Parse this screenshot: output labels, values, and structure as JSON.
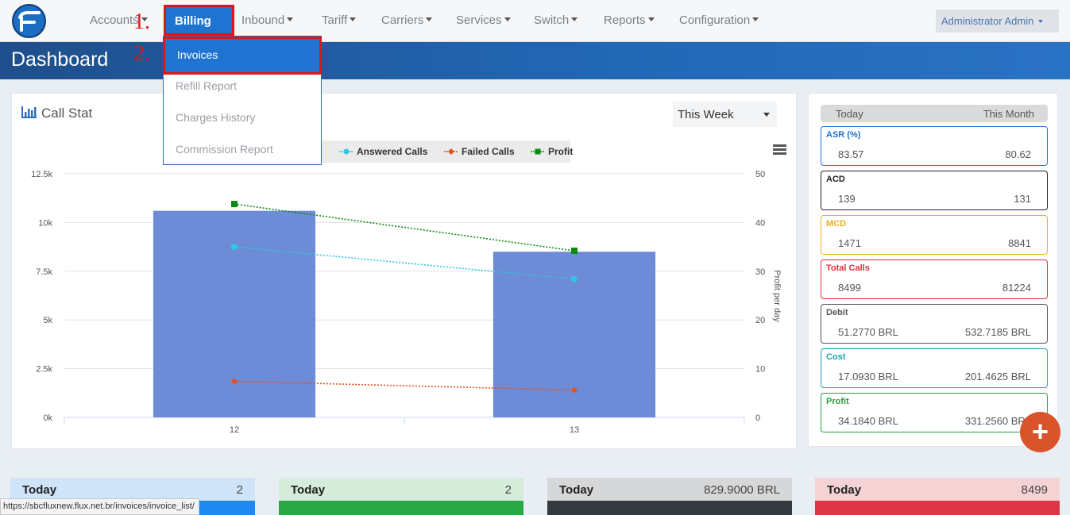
{
  "nav": {
    "items": [
      "Accounts",
      "Billing",
      "Inbound",
      "Tariff",
      "Carriers",
      "Services",
      "Switch",
      "Reports",
      "Configuration"
    ],
    "user": "Administrator Admin"
  },
  "annotations": [
    "1.",
    "2."
  ],
  "page_title": "Dashboard",
  "billing_menu": [
    "Invoices",
    "Refill Report",
    "Charges History",
    "Commission Report"
  ],
  "call_stat": {
    "title": "Call Stat",
    "period": "This Week",
    "legend": [
      "Answered Calls",
      "Failed Calls",
      "Profit"
    ],
    "colors": {
      "bars": "#6d8bd6",
      "answered": "#2fc6e0",
      "failed": "#e8501b",
      "profit": "#0a8a12"
    }
  },
  "chart_data": {
    "type": "bar",
    "categories": [
      "12",
      "13"
    ],
    "series": [
      {
        "type": "bar",
        "axis": "left",
        "values": [
          10600,
          8500
        ]
      },
      {
        "name": "Answered Calls",
        "type": "line",
        "axis": "left",
        "values": [
          8750,
          7100
        ]
      },
      {
        "name": "Failed Calls",
        "type": "line",
        "axis": "left",
        "values": [
          1850,
          1400
        ]
      },
      {
        "name": "Profit",
        "type": "line",
        "axis": "right",
        "values": [
          43.8,
          34.2
        ]
      }
    ],
    "y_left": {
      "ticks": [
        "0k",
        "2.5k",
        "5k",
        "7.5k",
        "10k",
        "12.5k"
      ],
      "range": [
        0,
        12500
      ]
    },
    "y_right": {
      "label": "Profit per day",
      "ticks": [
        "0",
        "10",
        "20",
        "30",
        "40",
        "50"
      ],
      "range": [
        0,
        50
      ]
    },
    "grid": true,
    "legend_position": "top"
  },
  "stats": {
    "headers": [
      "Today",
      "This Month"
    ],
    "cards": [
      {
        "label": "ASR (%)",
        "today": "83.57",
        "month": "80.62",
        "color": "#1e74d0"
      },
      {
        "label": "ACD",
        "today": "139",
        "month": "131",
        "color": "#222222"
      },
      {
        "label": "MCD",
        "today": "1471",
        "month": "8841",
        "color": "#f0ad1c"
      },
      {
        "label": "Total Calls",
        "today": "8499",
        "month": "81224",
        "color": "#d9303a"
      },
      {
        "label": "Debit",
        "today": "51.2770 BRL",
        "month": "532.7185 BRL",
        "color": "#555555"
      },
      {
        "label": "Cost",
        "today": "17.0930 BRL",
        "month": "201.4625 BRL",
        "color": "#1ba5b8"
      },
      {
        "label": "Profit",
        "today": "34.1840 BRL",
        "month": "331.2560 BRL",
        "color": "#2f9e44"
      }
    ]
  },
  "today_cards": [
    {
      "label": "Today",
      "value": "2",
      "head": "#cfe3f9",
      "body": "#1e88f0"
    },
    {
      "label": "Today",
      "value": "2",
      "head": "#d4ecd9",
      "body": "#28a745"
    },
    {
      "label": "Today",
      "value": "829.9000 BRL",
      "head": "#d6d7d9",
      "body": "#343a40"
    },
    {
      "label": "Today",
      "value": "8499",
      "head": "#f5d3d5",
      "body": "#dc3545"
    }
  ],
  "status_url": "https://sbcfluxnew.flux.net.br/invoices/invoice_list/"
}
